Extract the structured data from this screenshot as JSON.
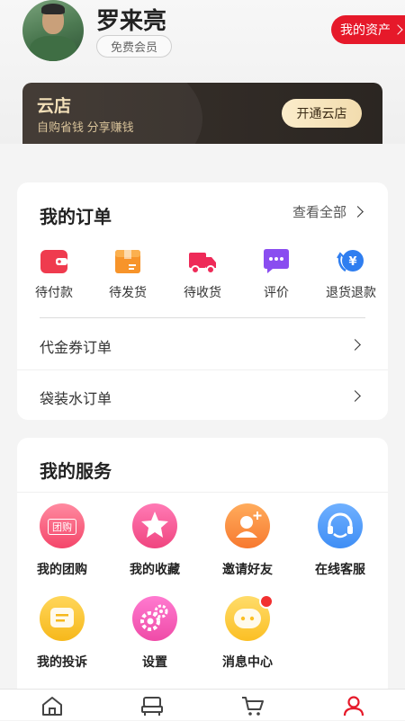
{
  "profile": {
    "name": "罗来亮",
    "member_level": "免费会员",
    "assets_label": "我的资产"
  },
  "cloud_store": {
    "title": "云店",
    "subtitle": "自购省钱 分享赚钱",
    "button": "开通云店"
  },
  "orders": {
    "title": "我的订单",
    "view_all": "查看全部",
    "statuses": [
      {
        "label": "待付款",
        "icon": "wallet-icon",
        "color": "#ef3b4e"
      },
      {
        "label": "待发货",
        "icon": "package-icon",
        "color": "#f7942a"
      },
      {
        "label": "待收货",
        "icon": "truck-icon",
        "color": "#ee2a58"
      },
      {
        "label": "评价",
        "icon": "comment-icon",
        "color": "#8a4df0"
      },
      {
        "label": "退货退款",
        "icon": "refund-icon",
        "color": "#2f7ef0"
      }
    ],
    "rows": [
      {
        "label": "代金券订单"
      },
      {
        "label": "袋装水订单"
      }
    ]
  },
  "services": {
    "title": "我的服务",
    "items": [
      {
        "label": "我的团购",
        "icon": "group-buy-icon",
        "badge_text": "团购",
        "color": "#f4466a"
      },
      {
        "label": "我的收藏",
        "icon": "favorite-icon",
        "color": "#f0457f"
      },
      {
        "label": "邀请好友",
        "icon": "invite-friend-icon",
        "color": "#f7792f"
      },
      {
        "label": "在线客服",
        "icon": "customer-service-icon",
        "color": "#3f8ef5"
      },
      {
        "label": "我的投诉",
        "icon": "complaint-icon",
        "color": "#f6b81b"
      },
      {
        "label": "设置",
        "icon": "settings-icon",
        "color": "#ef4ba7"
      },
      {
        "label": "消息中心",
        "icon": "message-center-icon",
        "color": "#fbbf24"
      }
    ]
  },
  "tabbar": {
    "items": [
      {
        "icon": "home-icon"
      },
      {
        "icon": "store-icon"
      },
      {
        "icon": "cart-icon"
      },
      {
        "icon": "profile-icon",
        "active": true,
        "active_color": "#e6192a"
      }
    ]
  }
}
